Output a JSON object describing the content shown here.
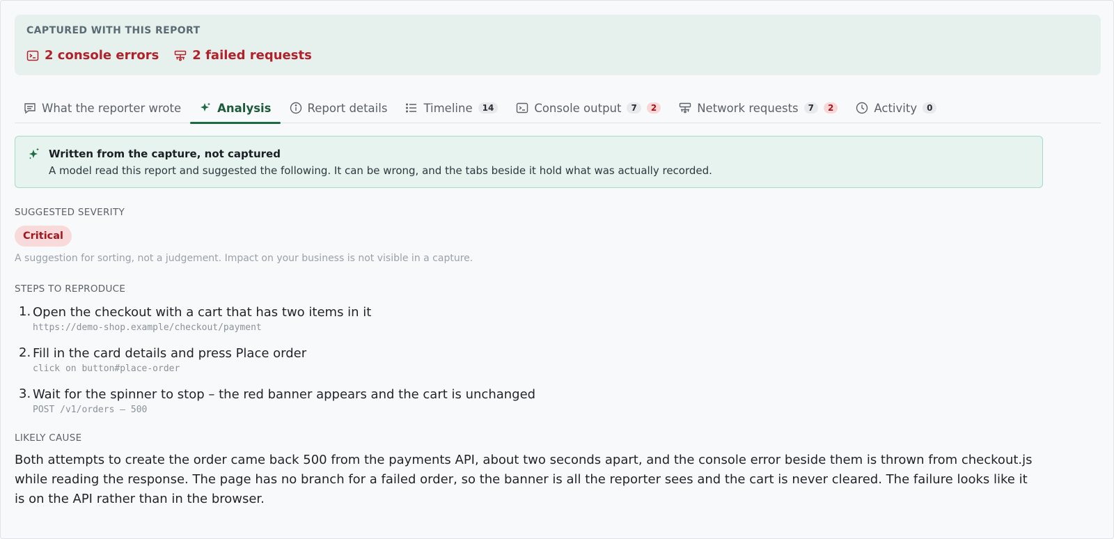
{
  "captured": {
    "label": "CAPTURED WITH THIS REPORT",
    "console_errors": "2 console errors",
    "failed_requests": "2 failed requests"
  },
  "tabs": [
    {
      "label": "What the reporter wrote",
      "icon": "comment-icon"
    },
    {
      "label": "Analysis",
      "icon": "sparkle-icon",
      "active": true
    },
    {
      "label": "Report details",
      "icon": "info-icon"
    },
    {
      "label": "Timeline",
      "icon": "list-icon",
      "badge": "14"
    },
    {
      "label": "Console output",
      "icon": "terminal-icon",
      "badge": "7",
      "badge_red": "2"
    },
    {
      "label": "Network requests",
      "icon": "network-icon",
      "badge": "7",
      "badge_red": "2"
    },
    {
      "label": "Activity",
      "icon": "clock-icon",
      "badge": "0"
    }
  ],
  "notice": {
    "title": "Written from the capture, not captured",
    "body": "A model read this report and suggested the following. It can be wrong, and the tabs beside it hold what was actually recorded."
  },
  "severity": {
    "label": "SUGGESTED SEVERITY",
    "value": "Critical",
    "hint": "A suggestion for sorting, not a judgement. Impact on your business is not visible in a capture."
  },
  "steps": {
    "label": "STEPS TO REPRODUCE",
    "items": [
      {
        "num": "1.",
        "text": "Open the checkout with a cart that has two items in it",
        "code": "https://demo-shop.example/checkout/payment"
      },
      {
        "num": "2.",
        "text": "Fill in the card details and press Place order",
        "code": "click on button#place-order"
      },
      {
        "num": "3.",
        "text": "Wait for the spinner to stop – the red banner appears and the cart is unchanged",
        "code": "POST /v1/orders – 500"
      }
    ]
  },
  "cause": {
    "label": "LIKELY CAUSE",
    "text": "Both attempts to create the order came back 500 from the payments API, about two seconds apart, and the console error beside them is thrown from checkout.js while reading the response. The page has no branch for a failed order, so the banner is all the reporter sees and the cart is never cleared. The failure looks like it is on the API rather than in the browser."
  },
  "colors": {
    "accent": "#1b6b45",
    "error": "#b3202a",
    "panel": "#e6f1ee"
  }
}
